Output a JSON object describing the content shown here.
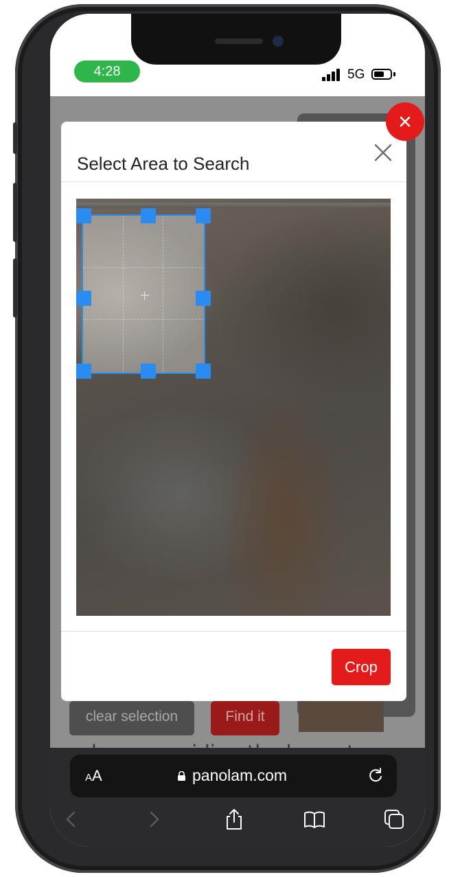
{
  "status_bar": {
    "time": "4:28",
    "network": "5G"
  },
  "background_page": {
    "clear_selection_label": "clear selection",
    "find_it_label": "Find it",
    "body_text": "been providing the largest"
  },
  "modal": {
    "title": "Select Area to Search",
    "crop_label": "Crop"
  },
  "browser": {
    "text_size_label_small": "A",
    "text_size_label_large": "A",
    "url": "panolam.com"
  },
  "colors": {
    "accent_red": "#e31b1b",
    "selection_blue": "#2a8cf0",
    "time_pill_green": "#2fb64b"
  },
  "icons": [
    "close-icon",
    "lock-icon",
    "reload-icon",
    "back-icon",
    "forward-icon",
    "share-icon",
    "bookmarks-icon",
    "tabs-icon"
  ]
}
